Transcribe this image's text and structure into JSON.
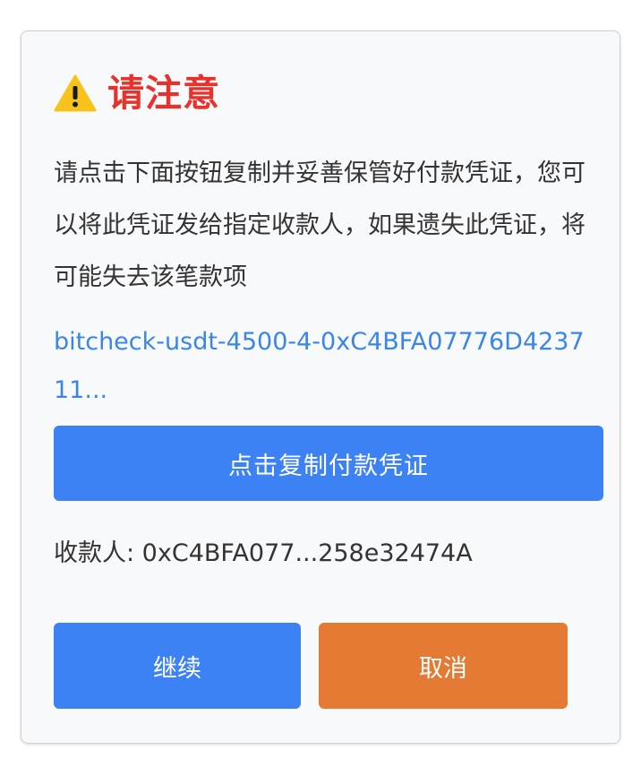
{
  "dialog": {
    "title": "请注意",
    "warning_icon": "warning-triangle-icon",
    "message": "请点击下面按钮复制并妥善保管好付款凭证，您可以将此凭证发给指定收款人，如果遗失此凭证，将可能失去该笔款项",
    "voucher_text": "bitcheck-usdt-4500-4-0xC4BFA07776D423711...",
    "copy_button_label": "点击复制付款凭证",
    "recipient_text": "收款人: 0xC4BFA077...258e32474A",
    "continue_button_label": "继续",
    "cancel_button_label": "取消"
  },
  "colors": {
    "title_red": "#e8312a",
    "primary_blue": "#3c82f5",
    "cancel_orange": "#e47a34",
    "link_blue": "#3a86e8",
    "warning_yellow": "#f7c21c"
  }
}
